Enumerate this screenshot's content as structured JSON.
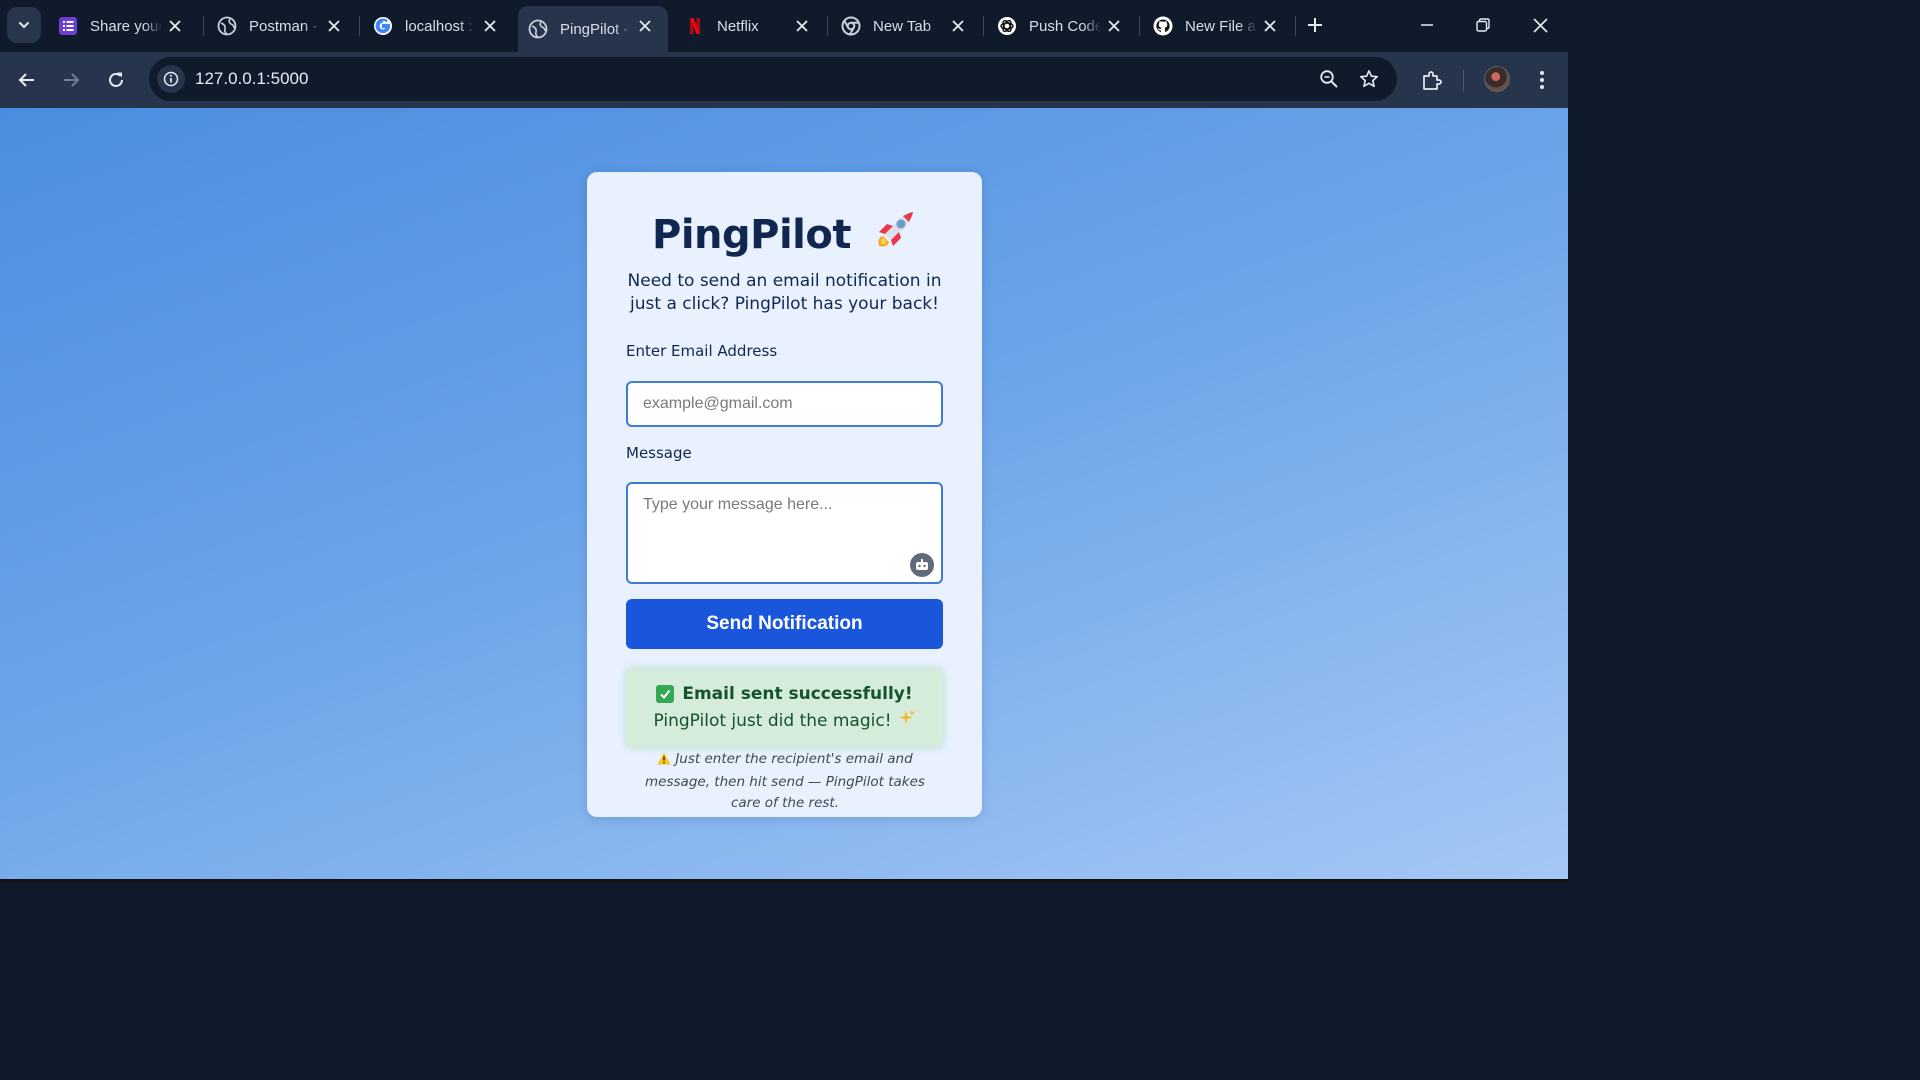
{
  "browser": {
    "tabs": [
      {
        "title": "Share your",
        "icon": "forms-icon"
      },
      {
        "title": "Postman -",
        "icon": "globe-icon"
      },
      {
        "title": "localhost :",
        "icon": "google-icon"
      },
      {
        "title": "PingPilot -",
        "icon": "globe-icon",
        "active": true
      },
      {
        "title": "Netflix",
        "icon": "netflix-icon"
      },
      {
        "title": "New Tab",
        "icon": "chrome-icon"
      },
      {
        "title": "Push Code",
        "icon": "openai-icon"
      },
      {
        "title": "New File a",
        "icon": "github-icon"
      }
    ],
    "url": "127.0.0.1:5000"
  },
  "app": {
    "title": "PingPilot",
    "tagline": "Need to send an email notification in just a click? PingPilot has your back!",
    "email_label": "Enter Email Address",
    "email_placeholder": "example@gmail.com",
    "message_label": "Message",
    "message_placeholder": "Type your message here...",
    "send_label": "Send Notification",
    "success_title": "Email sent successfully!",
    "success_sub": "PingPilot just did the magic!",
    "note": "Just enter the recipient's email and message, then hit send — PingPilot takes care of the rest."
  },
  "colors": {
    "accent": "#1a56db",
    "page_gradient_start": "#4a8de0",
    "page_gradient_end": "#a5c8f5",
    "card": "#e8f1fd",
    "success_bg": "#d4ecd9",
    "success_text": "#14532d"
  }
}
